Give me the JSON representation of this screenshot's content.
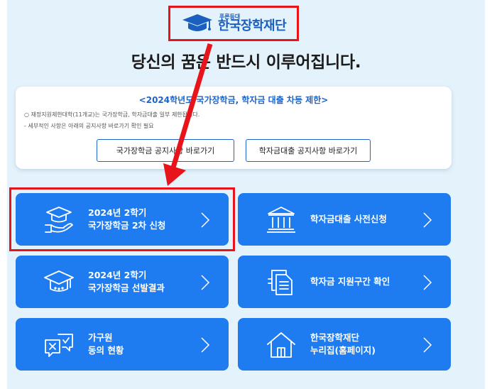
{
  "logo": {
    "sub_text": "푸른등대",
    "main_text": "한국장학재단"
  },
  "headline": "당신의 꿈은 반드시 이루어집니다.",
  "notice": {
    "title": "<2024학년도 국가장학금, 학자금 대출 차등 제한>",
    "line1": "○ 재정지원제한대학(11개교)는 국가장학금, 학자금대출 일부 제한됩니다.",
    "line2": "- 세부적인 사항은 아래의 공지사항 바로가기 확인 필요",
    "buttons": [
      "국가장학금 공지사항 바로가기",
      "학자금대출 공지사항 바로가기"
    ]
  },
  "tiles": [
    {
      "line1": "2024년 2학기",
      "line2": "국가장학금 2차 신청",
      "icon": "graduation-hand-icon"
    },
    {
      "line1": "학자금대출 사전신청",
      "line2": "",
      "icon": "bank-building-icon"
    },
    {
      "line1": "2024년 2학기",
      "line2": "국가장학금 선발결과",
      "icon": "graduation-cap-icon"
    },
    {
      "line1": "학자금 지원구간 확인",
      "line2": "",
      "icon": "document-list-icon"
    },
    {
      "line1": "가구원",
      "line2": "동의 현황",
      "icon": "check-chat-icon"
    },
    {
      "line1": "한국장학재단",
      "line2": "누리집(홈페이지)",
      "icon": "home-icon"
    }
  ],
  "colors": {
    "background": "#e4f2fb",
    "tile": "#1e7cf0",
    "brand": "#1b5fbf",
    "annotation": "#e8141b"
  }
}
